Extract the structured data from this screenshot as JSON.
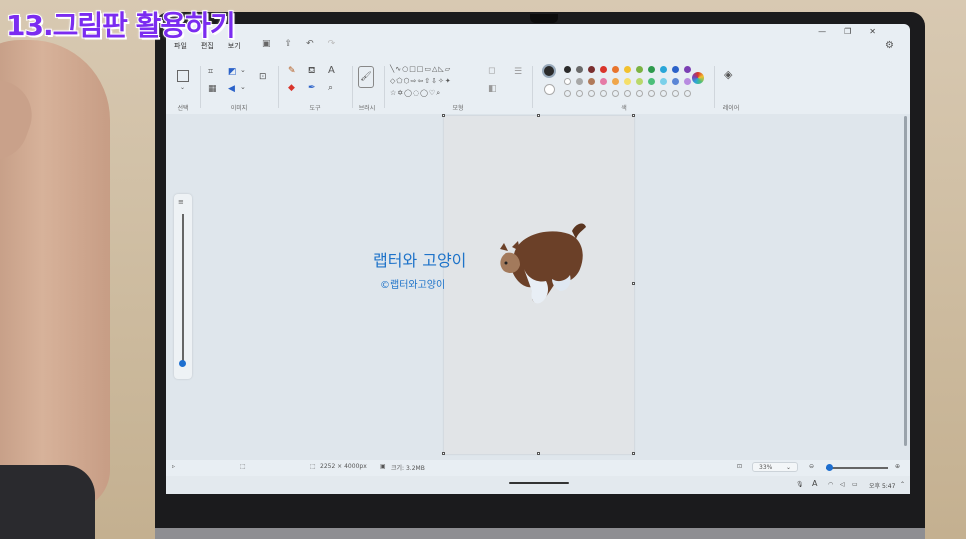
{
  "video_caption": "13.그림판 활용하기",
  "menu": {
    "file": "파일",
    "edit": "편집",
    "view": "보기"
  },
  "ribbon": {
    "groups": {
      "select": "선택",
      "image": "이미지",
      "tools": "도구",
      "brushes": "브러시",
      "shapes": "모형",
      "colors": "색",
      "layers": "레이어"
    },
    "colors_top": [
      "#2b2b2b",
      "#6b6b6b",
      "#7a2e2e",
      "#d9342b",
      "#e8742c",
      "#f2c12e",
      "#7cb342",
      "#2e9a4d",
      "#2aa6d8",
      "#2b62c9",
      "#7b3fb3"
    ],
    "colors_mid": [
      "#ffffff",
      "#a8a8a8",
      "#b07a5a",
      "#e57aa6",
      "#f0a64a",
      "#f5df6a",
      "#b9d86a",
      "#4cbf7a",
      "#7ad0ea",
      "#5b86d6",
      "#b88be0"
    ],
    "active_color_1": "#2b2b2b",
    "active_color_2": "#ffffff"
  },
  "canvas": {
    "text_main": "랩터와 고양이",
    "text_sub": "©랩터와고양이"
  },
  "statusbar": {
    "dimensions": "2252 × 4000px",
    "size": "크기: 3.2MB",
    "zoom": "33%"
  },
  "taskbar": {
    "time": "오후 5:47",
    "ime": "A"
  }
}
